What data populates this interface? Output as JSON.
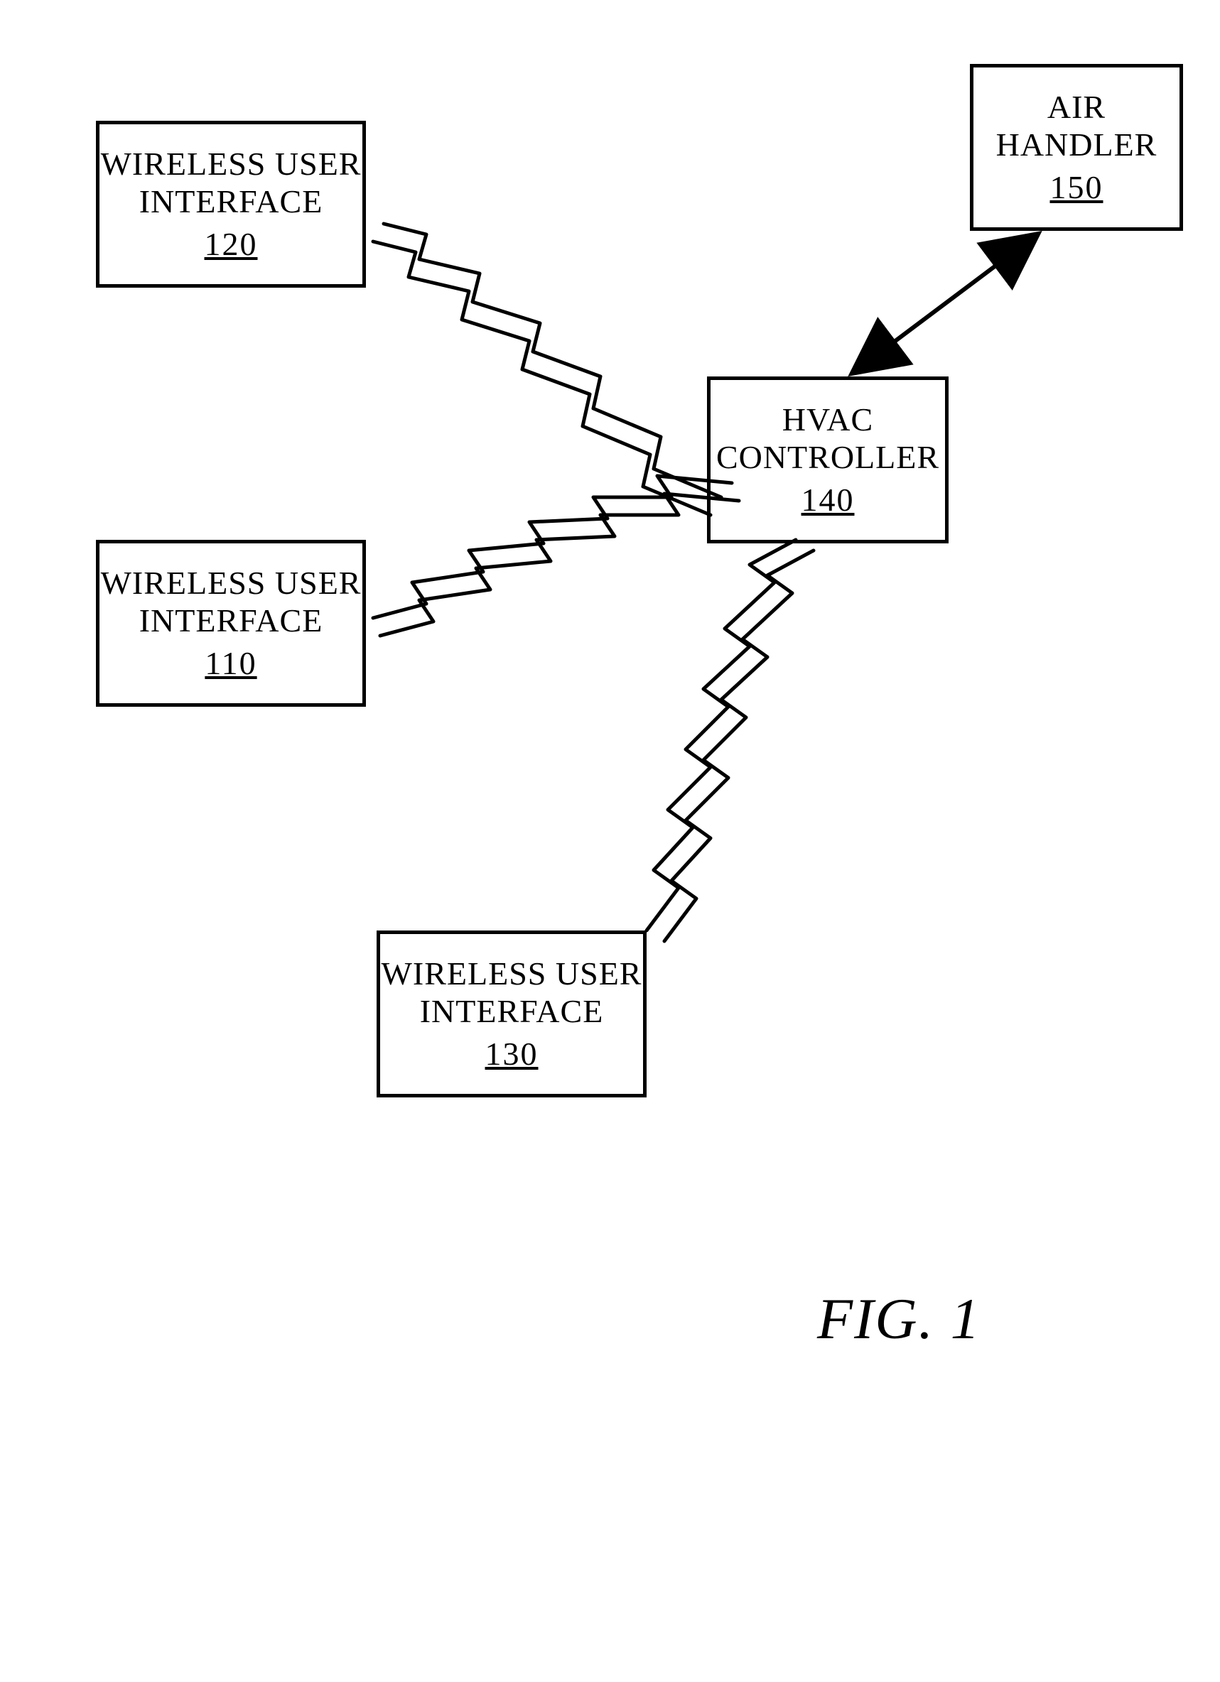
{
  "figure_label": "FIG.  1",
  "boxes": {
    "wui120": {
      "label": "WIRELESS USER\nINTERFACE",
      "ref": "120"
    },
    "wui110": {
      "label": "WIRELESS USER\nINTERFACE",
      "ref": "110"
    },
    "wui130": {
      "label": "WIRELESS USER\nINTERFACE",
      "ref": "130"
    },
    "hvac": {
      "label": "HVAC\nCONTROLLER",
      "ref": "140"
    },
    "air": {
      "label": "AIR\nHANDLER",
      "ref": "150"
    }
  }
}
